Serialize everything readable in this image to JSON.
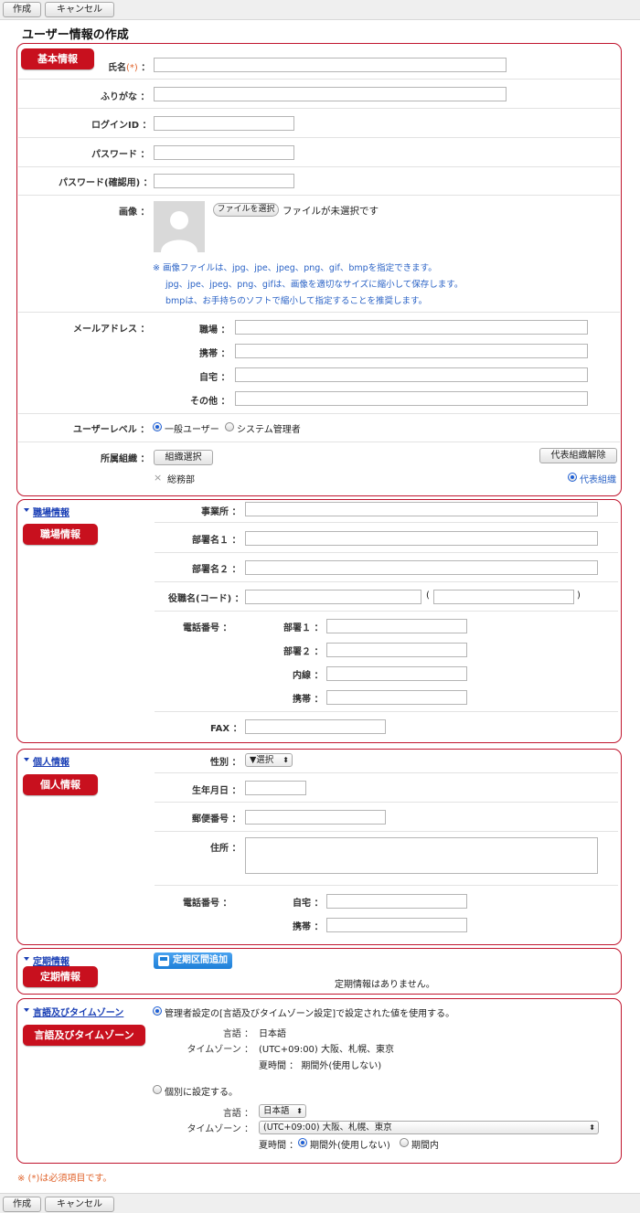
{
  "toolbar": {
    "create": "作成",
    "cancel": "キャンセル"
  },
  "page_title": "ユーザー情報の作成",
  "basic": {
    "badge": "基本情報",
    "name_label": "氏名",
    "required_mark": "(*)",
    "kana_label": "ふりがな",
    "login_label": "ログインID",
    "password_label": "パスワード",
    "password_confirm_label": "パスワード(確認用)",
    "image_label": "画像",
    "file_button": "ファイルを選択",
    "file_status": "ファイルが未選択です",
    "image_note_1": "※ 画像ファイルは、jpg、jpe、jpeg、png、gif、bmpを指定できます。",
    "image_note_2": "jpg、jpe、jpeg、png、gifは、画像を適切なサイズに縮小して保存します。",
    "image_note_3": "bmpは、お手持ちのソフトで縮小して指定することを推奨します。",
    "mail_label": "メールアドレス",
    "mail_work": "職場",
    "mail_mobile": "携帯",
    "mail_home": "自宅",
    "mail_other": "その他",
    "level_label": "ユーザーレベル",
    "level_general": "一般ユーザー",
    "level_admin": "システム管理者",
    "org_label": "所属組織",
    "org_select_button": "組織選択",
    "org_release_button": "代表組織解除",
    "org_item": "総務部",
    "org_representative": "代表組織"
  },
  "work": {
    "section_link": "職場情報",
    "badge": "職場情報",
    "office_label": "事業所",
    "dept1_label": "部署名１",
    "dept2_label": "部署名２",
    "title_label": "役職名(コード)",
    "paren_open": "(",
    "paren_close": ")",
    "phone_label": "電話番号",
    "phone_dept1": "部署１",
    "phone_dept2": "部署２",
    "phone_ext": "内線",
    "phone_mobile": "携帯",
    "fax_label": "FAX"
  },
  "personal": {
    "section_link": "個人情報",
    "badge": "個人情報",
    "gender_label": "性別",
    "gender_select": "▼選択",
    "birthday_label": "生年月日",
    "zip_label": "郵便番号",
    "address_label": "住所",
    "phone_label": "電話番号",
    "phone_home": "自宅",
    "phone_mobile": "携帯"
  },
  "commute": {
    "section_link": "定期情報",
    "badge": "定期情報",
    "add_button": "定期区間追加",
    "empty_text": "定期情報はありません。"
  },
  "locale": {
    "section_link": "言語及びタイムゾーン",
    "badge": "言語及びタイムゾーン",
    "option_admin": "管理者設定の[言語及びタイムゾーン設定]で設定された値を使用する。",
    "lang_label": "言語",
    "lang_value": "日本語",
    "tz_label": "タイムゾーン",
    "tz_value": "(UTC+09:00) 大阪、札幌、東京",
    "dst_label": "夏時間",
    "dst_value": "期間外(使用しない)",
    "option_individual": "個別に設定する。",
    "lang_select": "日本語",
    "tz_select": "(UTC+09:00) 大阪、札幌、東京",
    "dst_off": "期間外(使用しない)",
    "dst_on": "期間内"
  },
  "footer_note": "※ (*)は必須項目です。",
  "colors": {
    "frame": "#c0152e",
    "badge": "#c8101e",
    "link": "#1a3fb5",
    "note": "#2b63c6",
    "required": "#e0632b"
  }
}
